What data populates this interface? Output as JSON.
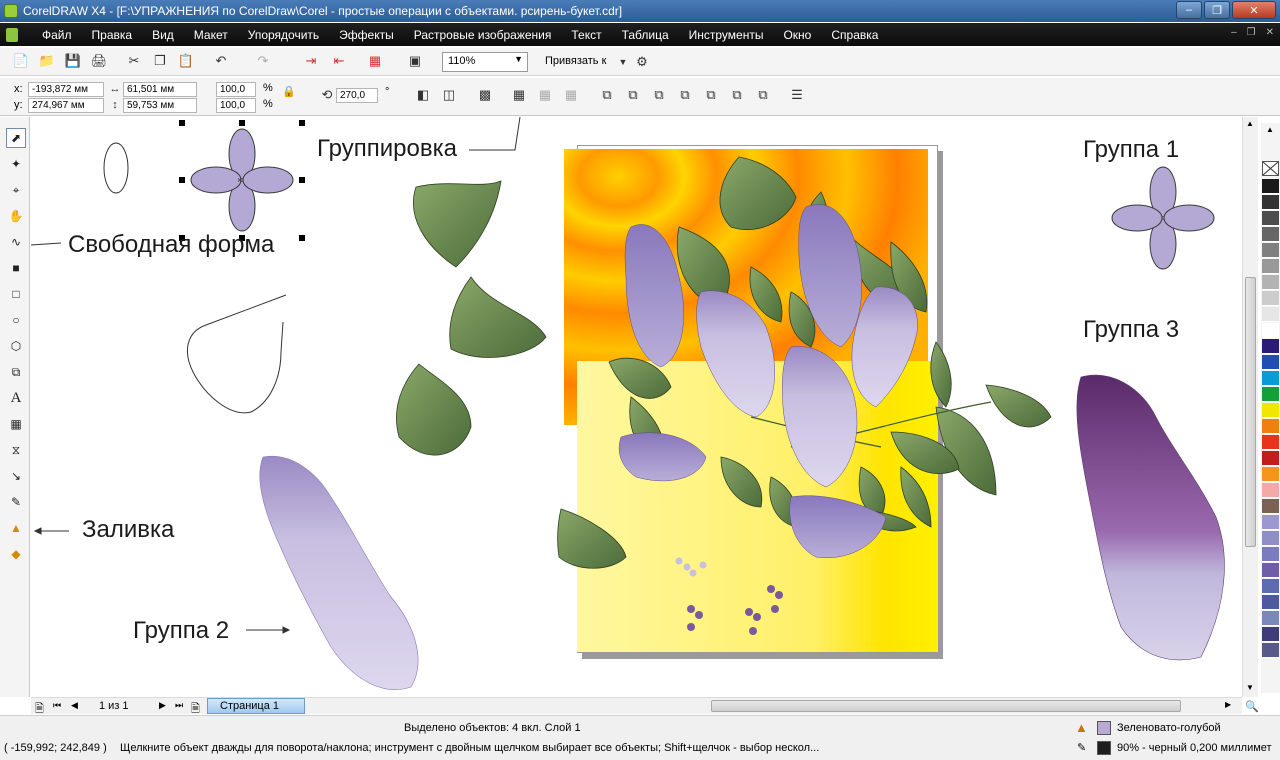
{
  "window": {
    "title": "CorelDRAW X4 - [F:\\УПРАЖНЕНИЯ по CorelDraw\\Corel - простые операции с объектами. рсирень-букет.cdr]"
  },
  "menu": {
    "items": [
      "Файл",
      "Правка",
      "Вид",
      "Макет",
      "Упорядочить",
      "Эффекты",
      "Растровые изображения",
      "Текст",
      "Таблица",
      "Инструменты",
      "Окно",
      "Справка"
    ]
  },
  "toolbar": {
    "zoom": "110%",
    "snap_label": "Привязать к"
  },
  "property_bar": {
    "x_label": "x:",
    "x_value": "-193,872 мм",
    "y_label": "y:",
    "y_value": "274,967 мм",
    "width_value": "61,501 мм",
    "height_value": "59,753 мм",
    "scale_x": "100,0",
    "scale_y": "100,0",
    "percent": "%",
    "rotation": "270,0",
    "degree": "°"
  },
  "canvas": {
    "annotations": {
      "grouping": "Группировка",
      "freeform": "Свободная форма",
      "fill": "Заливка",
      "group1": "Группа 1",
      "group2": "Группа 2",
      "group3": "Группа 3"
    }
  },
  "page_nav": {
    "counter": "1 из 1",
    "page_tab": "Страница 1"
  },
  "status": {
    "selection": "Выделено объектов: 4 вкл. Слой 1",
    "coords": "( -159,992; 242,849 )",
    "hint": "Щелкните объект дважды для поворота/наклона; инструмент с двойным щелчком выбирает все объекты; Shift+щелчок - выбор нескол...",
    "fill_name": "Зеленовато-голубой",
    "outline": "90% - черный   0,200 миллимет",
    "fill_color": "#b8a8d2",
    "outline_color": "#1e1e1e"
  },
  "palette": {
    "colors": [
      "#1a1a1a",
      "#333333",
      "#4d4d4d",
      "#666666",
      "#808080",
      "#999999",
      "#b3b3b3",
      "#cccccc",
      "#e6e6e6",
      "#ffffff",
      "#2b1a78",
      "#1f4fb5",
      "#0a9ad6",
      "#12a03a",
      "#f0e600",
      "#f07f12",
      "#e8341c",
      "#c21c1c",
      "#f7941d",
      "#f4a8a8",
      "#7a6254",
      "#9a9ad0",
      "#8f8fc8",
      "#7b7bbf",
      "#6f5ea7",
      "#5f6bb0",
      "#4d5aa0",
      "#7a8ab8",
      "#3d3d7a",
      "#5a5a8a"
    ]
  }
}
